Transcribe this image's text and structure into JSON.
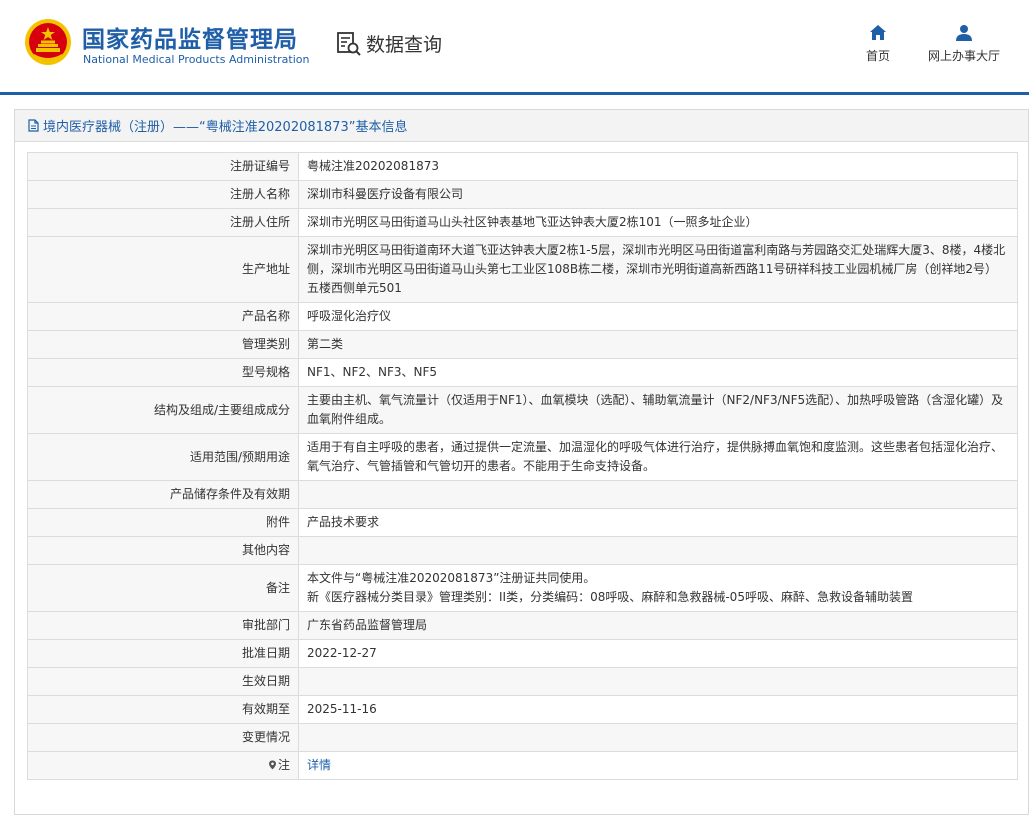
{
  "header": {
    "agency_cn": "国家药品监督管理局",
    "agency_en": "National Medical Products Administration",
    "query_label": "数据查询",
    "nav": {
      "home": "首页",
      "hall": "网上办事大厅"
    }
  },
  "panel": {
    "title": "境内医疗器械（注册）——“粤械注准20202081873”基本信息"
  },
  "rows": [
    {
      "label": "注册证编号",
      "value": "粤械注准20202081873"
    },
    {
      "label": "注册人名称",
      "value": "深圳市科曼医疗设备有限公司"
    },
    {
      "label": "注册人住所",
      "value": "深圳市光明区马田街道马山头社区钟表基地飞亚达钟表大厦2栋101（一照多址企业）"
    },
    {
      "label": "生产地址",
      "value": "深圳市光明区马田街道南环大道飞亚达钟表大厦2栋1-5层，深圳市光明区马田街道富利南路与芳园路交汇处瑞辉大厦3、8楼，4楼北侧，深圳市光明区马田街道马山头第七工业区108B栋二楼，深圳市光明街道高新西路11号研祥科技工业园机械厂房（创祥地2号）五楼西侧单元501"
    },
    {
      "label": "产品名称",
      "value": "呼吸湿化治疗仪"
    },
    {
      "label": "管理类别",
      "value": "第二类"
    },
    {
      "label": "型号规格",
      "value": "NF1、NF2、NF3、NF5"
    },
    {
      "label": "结构及组成/主要组成成分",
      "value": "主要由主机、氧气流量计（仅适用于NF1）、血氧模块（选配）、辅助氧流量计（NF2/NF3/NF5选配）、加热呼吸管路（含湿化罐）及血氧附件组成。"
    },
    {
      "label": "适用范围/预期用途",
      "value": "适用于有自主呼吸的患者，通过提供一定流量、加温湿化的呼吸气体进行治疗，提供脉搏血氧饱和度监测。这些患者包括湿化治疗、氧气治疗、气管插管和气管切开的患者。不能用于生命支持设备。"
    },
    {
      "label": "产品储存条件及有效期",
      "value": ""
    },
    {
      "label": "附件",
      "value": "产品技术要求"
    },
    {
      "label": "其他内容",
      "value": ""
    },
    {
      "label": "备注",
      "value": "本文件与“粤械注准20202081873”注册证共同使用。\n新《医疗器械分类目录》管理类别：II类，分类编码：08呼吸、麻醉和急救器械-05呼吸、麻醉、急救设备辅助装置"
    },
    {
      "label": "审批部门",
      "value": "广东省药品监督管理局"
    },
    {
      "label": "批准日期",
      "value": "2022-12-27"
    },
    {
      "label": "生效日期",
      "value": ""
    },
    {
      "label": "有效期至",
      "value": "2025-11-16"
    },
    {
      "label": "变更情况",
      "value": ""
    }
  ],
  "note": {
    "label": "注",
    "link": "详情"
  },
  "colors": {
    "brand_blue": "#1f5fa8",
    "emblem_red": "#d7000f",
    "emblem_gold": "#f4c300"
  }
}
